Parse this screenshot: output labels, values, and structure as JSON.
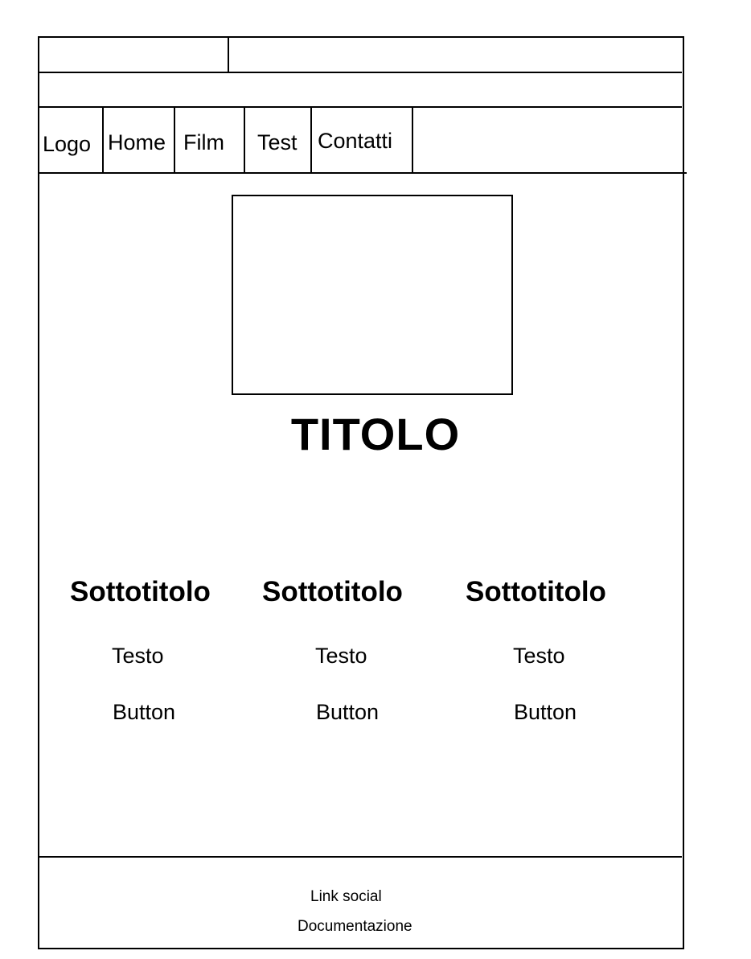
{
  "nav": {
    "logo": "Logo",
    "items": [
      {
        "label": "Home"
      },
      {
        "label": "Film"
      },
      {
        "label": "Test"
      },
      {
        "label": "Contatti"
      }
    ]
  },
  "main": {
    "title": "TITOLO",
    "columns": [
      {
        "subtitle": "Sottotitolo",
        "text": "Testo",
        "button": "Button"
      },
      {
        "subtitle": "Sottotitolo",
        "text": "Testo",
        "button": "Button"
      },
      {
        "subtitle": "Sottotitolo",
        "text": "Testo",
        "button": "Button"
      }
    ]
  },
  "footer": {
    "social": "Link social",
    "docs": "Documentazione"
  }
}
